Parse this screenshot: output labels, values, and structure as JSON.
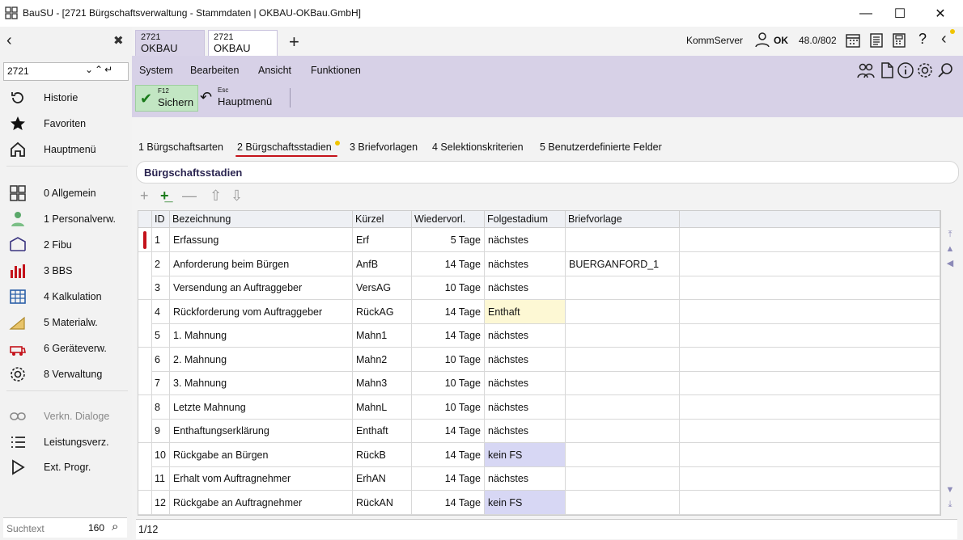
{
  "window": {
    "title": "BauSU - [2721 Bürgschaftsverwaltung - Stammdaten | OKBAU-OKBau.GmbH]"
  },
  "sidebar": {
    "search_value": "2721",
    "items": [
      {
        "label": "Historie",
        "icon": "history-icon"
      },
      {
        "label": "Favoriten",
        "icon": "star-icon"
      },
      {
        "label": "Hauptmenü",
        "icon": "home-icon"
      },
      {
        "label": "0 Allgemein",
        "icon": "general-icon"
      },
      {
        "label": "1 Personalverw.",
        "icon": "personnel-icon"
      },
      {
        "label": "2 Fibu",
        "icon": "fibu-icon"
      },
      {
        "label": "3 BBS",
        "icon": "bbs-icon"
      },
      {
        "label": "4 Kalkulation",
        "icon": "calculation-icon"
      },
      {
        "label": "5 Materialw.",
        "icon": "material-icon"
      },
      {
        "label": "6 Geräteverw.",
        "icon": "equipment-icon"
      },
      {
        "label": "8 Verwaltung",
        "icon": "gear-icon"
      },
      {
        "label": "Verkn. Dialoge",
        "icon": "link-icon"
      },
      {
        "label": "Leistungsverz.",
        "icon": "list-icon"
      },
      {
        "label": "Ext. Progr.",
        "icon": "play-icon"
      }
    ],
    "bottom_placeholder": "Suchtext",
    "bottom_count": "160"
  },
  "tabs": [
    {
      "line1": "2721",
      "line2": "OKBAU"
    },
    {
      "line1": "2721",
      "line2": "OKBAU"
    }
  ],
  "status": {
    "server": "KommServer",
    "ok": "OK",
    "version": "48.0/802"
  },
  "menu": [
    "System",
    "Bearbeiten",
    "Ansicht",
    "Funktionen"
  ],
  "toolbar": {
    "save_key": "F12",
    "save_label": "Sichern",
    "menu_key": "Esc",
    "menu_label": "Hauptmenü"
  },
  "subtabs": [
    "1 Bürgschaftsarten",
    "2 Bürgschaftsstadien",
    "3 Briefvorlagen",
    "4 Selektionskriterien",
    "5 Benutzerdefinierte Felder"
  ],
  "section_title": "Bürgschaftsstadien",
  "grid": {
    "columns": [
      "ID",
      "Bezeichnung",
      "Kürzel",
      "Wiedervorl.",
      "Folgestadium",
      "Briefvorlage"
    ],
    "rows": [
      {
        "id": "1",
        "name": "Erfassung",
        "short": "Erf",
        "wv": "5 Tage",
        "fs": "nächstes",
        "bv": ""
      },
      {
        "id": "2",
        "name": "Anforderung beim Bürgen",
        "short": "AnfB",
        "wv": "14 Tage",
        "fs": "nächstes",
        "bv": "BUERGANFORD_1"
      },
      {
        "id": "3",
        "name": "Versendung an Auftraggeber",
        "short": "VersAG",
        "wv": "10 Tage",
        "fs": "nächstes",
        "bv": ""
      },
      {
        "id": "4",
        "name": "Rückforderung vom Auftraggeber",
        "short": "RückAG",
        "wv": "14 Tage",
        "fs": "Enthaft",
        "bv": ""
      },
      {
        "id": "5",
        "name": "1. Mahnung",
        "short": "Mahn1",
        "wv": "14 Tage",
        "fs": "nächstes",
        "bv": ""
      },
      {
        "id": "6",
        "name": "2. Mahnung",
        "short": "Mahn2",
        "wv": "10 Tage",
        "fs": "nächstes",
        "bv": ""
      },
      {
        "id": "7",
        "name": "3. Mahnung",
        "short": "Mahn3",
        "wv": "10 Tage",
        "fs": "nächstes",
        "bv": ""
      },
      {
        "id": "8",
        "name": "Letzte Mahnung",
        "short": "MahnL",
        "wv": "10 Tage",
        "fs": "nächstes",
        "bv": ""
      },
      {
        "id": "9",
        "name": "Enthaftungserklärung",
        "short": "Enthaft",
        "wv": "14 Tage",
        "fs": "nächstes",
        "bv": ""
      },
      {
        "id": "10",
        "name": "Rückgabe an Bürgen",
        "short": "RückB",
        "wv": "14 Tage",
        "fs": "kein FS",
        "bv": ""
      },
      {
        "id": "11",
        "name": "Erhalt vom Auftragnehmer",
        "short": "ErhAN",
        "wv": "14 Tage",
        "fs": "nächstes",
        "bv": ""
      },
      {
        "id": "12",
        "name": "Rückgabe an Auftragnehmer",
        "short": "RückAN",
        "wv": "14 Tage",
        "fs": "kein FS",
        "bv": ""
      }
    ]
  },
  "footer": "1/12",
  "colors": {
    "accent": "#d7d1e7",
    "save": "#c2e6c3",
    "mark": "#c4121a",
    "highlight_yellow": "#fdf8d4",
    "highlight_blue": "#d7d7f4"
  }
}
